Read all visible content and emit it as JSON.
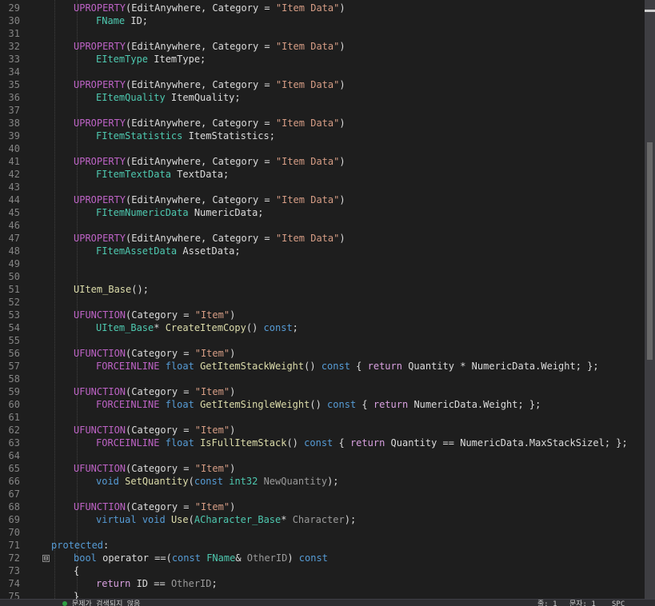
{
  "editor": {
    "lines": [
      {
        "n": "29",
        "fold": null,
        "tokens": [
          [
            "mac",
            "UPROPERTY"
          ],
          [
            "plain",
            "(EditAnywhere, Category = "
          ],
          [
            "str",
            "\"Item Data\""
          ],
          [
            "plain",
            ")"
          ]
        ],
        "indent": 2
      },
      {
        "n": "30",
        "fold": null,
        "tokens": [
          [
            "type",
            "FName"
          ],
          [
            "plain",
            " ID;"
          ]
        ],
        "indent": 3
      },
      {
        "n": "31",
        "fold": null,
        "tokens": [],
        "indent": 2
      },
      {
        "n": "32",
        "fold": null,
        "tokens": [
          [
            "mac",
            "UPROPERTY"
          ],
          [
            "plain",
            "(EditAnywhere, Category = "
          ],
          [
            "str",
            "\"Item Data\""
          ],
          [
            "plain",
            ")"
          ]
        ],
        "indent": 2
      },
      {
        "n": "33",
        "fold": null,
        "tokens": [
          [
            "type",
            "EItemType"
          ],
          [
            "plain",
            " ItemType;"
          ]
        ],
        "indent": 3
      },
      {
        "n": "34",
        "fold": null,
        "tokens": [],
        "indent": 2
      },
      {
        "n": "35",
        "fold": null,
        "tokens": [
          [
            "mac",
            "UPROPERTY"
          ],
          [
            "plain",
            "(EditAnywhere, Category = "
          ],
          [
            "str",
            "\"Item Data\""
          ],
          [
            "plain",
            ")"
          ]
        ],
        "indent": 2
      },
      {
        "n": "36",
        "fold": null,
        "tokens": [
          [
            "type",
            "EItemQuality"
          ],
          [
            "plain",
            " ItemQuality;"
          ]
        ],
        "indent": 3
      },
      {
        "n": "37",
        "fold": null,
        "tokens": [],
        "indent": 2
      },
      {
        "n": "38",
        "fold": null,
        "tokens": [
          [
            "mac",
            "UPROPERTY"
          ],
          [
            "plain",
            "(EditAnywhere, Category = "
          ],
          [
            "str",
            "\"Item Data\""
          ],
          [
            "plain",
            ")"
          ]
        ],
        "indent": 2
      },
      {
        "n": "39",
        "fold": null,
        "tokens": [
          [
            "type",
            "FItemStatistics"
          ],
          [
            "plain",
            " ItemStatistics;"
          ]
        ],
        "indent": 3
      },
      {
        "n": "40",
        "fold": null,
        "tokens": [],
        "indent": 2
      },
      {
        "n": "41",
        "fold": null,
        "tokens": [
          [
            "mac",
            "UPROPERTY"
          ],
          [
            "plain",
            "(EditAnywhere, Category = "
          ],
          [
            "str",
            "\"Item Data\""
          ],
          [
            "plain",
            ")"
          ]
        ],
        "indent": 2
      },
      {
        "n": "42",
        "fold": null,
        "tokens": [
          [
            "type",
            "FItemTextData"
          ],
          [
            "plain",
            " TextData;"
          ]
        ],
        "indent": 3
      },
      {
        "n": "43",
        "fold": null,
        "tokens": [],
        "indent": 2
      },
      {
        "n": "44",
        "fold": null,
        "tokens": [
          [
            "mac",
            "UPROPERTY"
          ],
          [
            "plain",
            "(EditAnywhere, Category = "
          ],
          [
            "str",
            "\"Item Data\""
          ],
          [
            "plain",
            ")"
          ]
        ],
        "indent": 2
      },
      {
        "n": "45",
        "fold": null,
        "tokens": [
          [
            "type",
            "FItemNumericData"
          ],
          [
            "plain",
            " NumericData;"
          ]
        ],
        "indent": 3
      },
      {
        "n": "46",
        "fold": null,
        "tokens": [],
        "indent": 2
      },
      {
        "n": "47",
        "fold": null,
        "tokens": [
          [
            "mac",
            "UPROPERTY"
          ],
          [
            "plain",
            "(EditAnywhere, Category = "
          ],
          [
            "str",
            "\"Item Data\""
          ],
          [
            "plain",
            ")"
          ]
        ],
        "indent": 2
      },
      {
        "n": "48",
        "fold": null,
        "tokens": [
          [
            "type",
            "FItemAssetData"
          ],
          [
            "plain",
            " AssetData;"
          ]
        ],
        "indent": 3
      },
      {
        "n": "49",
        "fold": null,
        "tokens": [],
        "indent": 2
      },
      {
        "n": "50",
        "fold": null,
        "tokens": [],
        "indent": 2
      },
      {
        "n": "51",
        "fold": null,
        "tokens": [
          [
            "fn",
            "UItem_Base"
          ],
          [
            "plain",
            "();"
          ]
        ],
        "indent": 2
      },
      {
        "n": "52",
        "fold": null,
        "tokens": [],
        "indent": 2
      },
      {
        "n": "53",
        "fold": null,
        "tokens": [
          [
            "mac",
            "UFUNCTION"
          ],
          [
            "plain",
            "(Category = "
          ],
          [
            "str",
            "\"Item\""
          ],
          [
            "plain",
            ")"
          ]
        ],
        "indent": 2
      },
      {
        "n": "54",
        "fold": null,
        "tokens": [
          [
            "type",
            "UItem_Base"
          ],
          [
            "plain",
            "* "
          ],
          [
            "fn",
            "CreateItemCopy"
          ],
          [
            "plain",
            "() "
          ],
          [
            "kw",
            "const"
          ],
          [
            "plain",
            ";"
          ]
        ],
        "indent": 3
      },
      {
        "n": "55",
        "fold": null,
        "tokens": [],
        "indent": 2
      },
      {
        "n": "56",
        "fold": null,
        "tokens": [
          [
            "mac",
            "UFUNCTION"
          ],
          [
            "plain",
            "(Category = "
          ],
          [
            "str",
            "\"Item\""
          ],
          [
            "plain",
            ")"
          ]
        ],
        "indent": 2
      },
      {
        "n": "57",
        "fold": null,
        "tokens": [
          [
            "mac",
            "FORCEINLINE"
          ],
          [
            "plain",
            " "
          ],
          [
            "kw",
            "float"
          ],
          [
            "plain",
            " "
          ],
          [
            "fn",
            "GetItemStackWeight"
          ],
          [
            "plain",
            "() "
          ],
          [
            "kw",
            "const"
          ],
          [
            "plain",
            " { "
          ],
          [
            "ctl",
            "return"
          ],
          [
            "plain",
            " Quantity * NumericData.Weight; };"
          ]
        ],
        "indent": 3
      },
      {
        "n": "58",
        "fold": null,
        "tokens": [],
        "indent": 2
      },
      {
        "n": "59",
        "fold": null,
        "tokens": [
          [
            "mac",
            "UFUNCTION"
          ],
          [
            "plain",
            "(Category = "
          ],
          [
            "str",
            "\"Item\""
          ],
          [
            "plain",
            ")"
          ]
        ],
        "indent": 2
      },
      {
        "n": "60",
        "fold": null,
        "tokens": [
          [
            "mac",
            "FORCEINLINE"
          ],
          [
            "plain",
            " "
          ],
          [
            "kw",
            "float"
          ],
          [
            "plain",
            " "
          ],
          [
            "fn",
            "GetItemSingleWeight"
          ],
          [
            "plain",
            "() "
          ],
          [
            "kw",
            "const"
          ],
          [
            "plain",
            " { "
          ],
          [
            "ctl",
            "return"
          ],
          [
            "plain",
            " NumericData.Weight; };"
          ]
        ],
        "indent": 3
      },
      {
        "n": "61",
        "fold": null,
        "tokens": [],
        "indent": 2
      },
      {
        "n": "62",
        "fold": null,
        "tokens": [
          [
            "mac",
            "UFUNCTION"
          ],
          [
            "plain",
            "(Category = "
          ],
          [
            "str",
            "\"Item\""
          ],
          [
            "plain",
            ")"
          ]
        ],
        "indent": 2
      },
      {
        "n": "63",
        "fold": null,
        "tokens": [
          [
            "mac",
            "FORCEINLINE"
          ],
          [
            "plain",
            " "
          ],
          [
            "kw",
            "float"
          ],
          [
            "plain",
            " "
          ],
          [
            "fn",
            "IsFullItemStack"
          ],
          [
            "plain",
            "() "
          ],
          [
            "kw",
            "const"
          ],
          [
            "plain",
            " { "
          ],
          [
            "ctl",
            "return"
          ],
          [
            "plain",
            " Quantity == NumericData.MaxStackSizel; };"
          ]
        ],
        "indent": 3
      },
      {
        "n": "64",
        "fold": null,
        "tokens": [],
        "indent": 2
      },
      {
        "n": "65",
        "fold": null,
        "tokens": [
          [
            "mac",
            "UFUNCTION"
          ],
          [
            "plain",
            "(Category = "
          ],
          [
            "str",
            "\"Item\""
          ],
          [
            "plain",
            ")"
          ]
        ],
        "indent": 2
      },
      {
        "n": "66",
        "fold": null,
        "tokens": [
          [
            "kw",
            "void"
          ],
          [
            "plain",
            " "
          ],
          [
            "fn",
            "SetQuantity"
          ],
          [
            "plain",
            "("
          ],
          [
            "kw",
            "const"
          ],
          [
            "plain",
            " "
          ],
          [
            "type",
            "int32"
          ],
          [
            "plain",
            " "
          ],
          [
            "param",
            "NewQuantity"
          ],
          [
            "plain",
            ");"
          ]
        ],
        "indent": 3
      },
      {
        "n": "67",
        "fold": null,
        "tokens": [],
        "indent": 2
      },
      {
        "n": "68",
        "fold": null,
        "tokens": [
          [
            "mac",
            "UFUNCTION"
          ],
          [
            "plain",
            "(Category = "
          ],
          [
            "str",
            "\"Item\""
          ],
          [
            "plain",
            ")"
          ]
        ],
        "indent": 2
      },
      {
        "n": "69",
        "fold": null,
        "tokens": [
          [
            "kw",
            "virtual"
          ],
          [
            "plain",
            " "
          ],
          [
            "kw",
            "void"
          ],
          [
            "plain",
            " "
          ],
          [
            "fn",
            "Use"
          ],
          [
            "plain",
            "("
          ],
          [
            "type",
            "ACharacter_Base"
          ],
          [
            "plain",
            "* "
          ],
          [
            "param",
            "Character"
          ],
          [
            "plain",
            ");"
          ]
        ],
        "indent": 3
      },
      {
        "n": "70",
        "fold": null,
        "tokens": [],
        "indent": 1
      },
      {
        "n": "71",
        "fold": null,
        "tokens": [
          [
            "kw",
            "protected"
          ],
          [
            "plain",
            ":"
          ]
        ],
        "indent": 1
      },
      {
        "n": "72",
        "fold": "⊟",
        "tokens": [
          [
            "kw",
            "bool"
          ],
          [
            "plain",
            " operator ==("
          ],
          [
            "kw",
            "const"
          ],
          [
            "plain",
            " "
          ],
          [
            "type",
            "FName"
          ],
          [
            "plain",
            "& "
          ],
          [
            "param",
            "OtherID"
          ],
          [
            "plain",
            ") "
          ],
          [
            "kw",
            "const"
          ]
        ],
        "indent": 2
      },
      {
        "n": "73",
        "fold": null,
        "tokens": [
          [
            "plain",
            "{"
          ]
        ],
        "indent": 2
      },
      {
        "n": "74",
        "fold": null,
        "tokens": [
          [
            "ctl",
            "return"
          ],
          [
            "plain",
            " ID == "
          ],
          [
            "param",
            "OtherID"
          ],
          [
            "plain",
            ";"
          ]
        ],
        "indent": 3
      },
      {
        "n": "75",
        "fold": null,
        "tokens": [
          [
            "plain",
            "}"
          ]
        ],
        "indent": 2
      }
    ]
  },
  "statusbar": {
    "left_text": "문제가 검색되지 않음",
    "right_text_1": "줄: 1",
    "right_text_2": "문자: 1",
    "right_text_3": "SPC"
  },
  "colors": {
    "background": "#1e1e1e",
    "line_number": "#858585",
    "macro": "#bd63c5",
    "string": "#d69d85",
    "type": "#4ec9b0",
    "keyword": "#569cd6",
    "function": "#dcdcaa"
  }
}
